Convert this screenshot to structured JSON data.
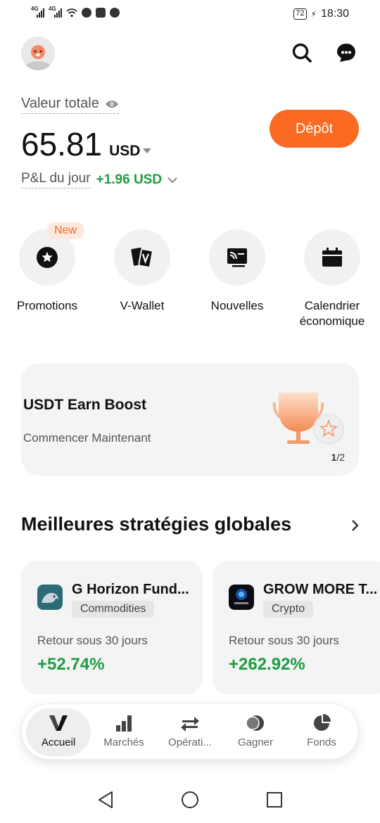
{
  "status_bar": {
    "signal1_tag": "4G",
    "signal2_tag": "4G",
    "battery": "72",
    "time": "18:30"
  },
  "header": {
    "icons": [
      "avatar",
      "search-icon",
      "chat-icon"
    ]
  },
  "balance": {
    "label": "Valeur totale",
    "amount": "65.81",
    "currency": "USD",
    "pnl_label": "P&L du jour",
    "pnl_value": "+1.96 USD",
    "deposit_label": "Dépôt"
  },
  "quick_actions": [
    {
      "label": "Promotions",
      "icon": "star-icon",
      "badge": "New"
    },
    {
      "label": "V-Wallet",
      "icon": "wallet-cards-icon"
    },
    {
      "label": "Nouvelles",
      "icon": "news-icon"
    },
    {
      "label": "Calendrier économique",
      "icon": "calendar-icon"
    }
  ],
  "promo": {
    "title": "USDT Earn Boost",
    "subtitle": "Commencer Maintenant",
    "page_current": "1",
    "page_total": "/2"
  },
  "strategies": {
    "title": "Meilleures stratégies globales",
    "cards": [
      {
        "name": "G Horizon Fund...",
        "tag": "Commodities",
        "return_label": "Retour sous 30 jours",
        "return_value": "+52.74%"
      },
      {
        "name": "GROW MORE T...",
        "tag": "Crypto",
        "return_label": "Retour sous 30 jours",
        "return_value": "+262.92%"
      }
    ]
  },
  "bottom_nav": [
    {
      "label": "Accueil",
      "icon": "home-logo-icon",
      "active": true
    },
    {
      "label": "Marchés",
      "icon": "bar-chart-icon"
    },
    {
      "label": "Opérati...",
      "icon": "swap-icon"
    },
    {
      "label": "Gagner",
      "icon": "coin-icon"
    },
    {
      "label": "Fonds",
      "icon": "pie-chart-icon"
    }
  ],
  "colors": {
    "accent": "#fb6a22",
    "positive": "#1b9e3e",
    "card_bg": "#f4f4f4"
  }
}
